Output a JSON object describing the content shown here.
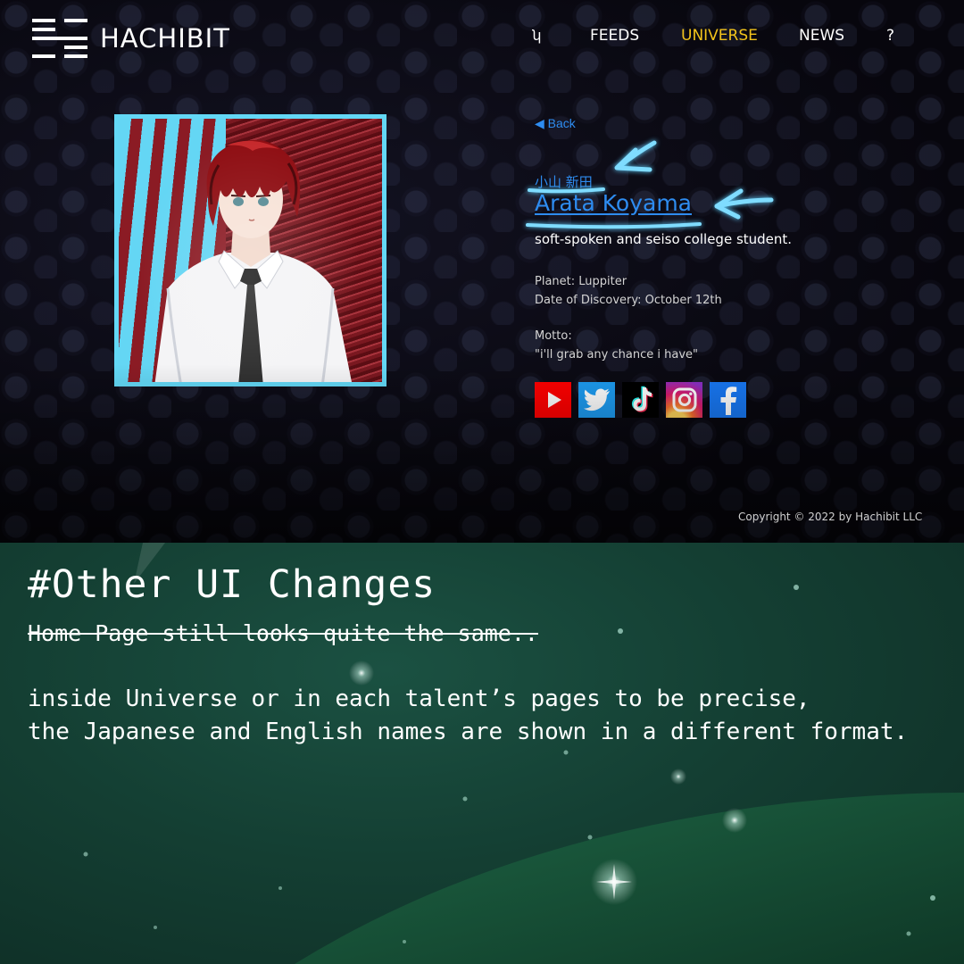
{
  "site": {
    "logo_text": "HACHIBIT",
    "nav": {
      "home": "ʮ",
      "feeds": "FEEDS",
      "universe": "UNIVERSE",
      "news": "NEWS",
      "help": "?"
    },
    "active_nav": "UNIVERSE",
    "accent_color": "#f2c31b",
    "link_color": "#2e8cf0",
    "portrait_border_color": "#63d8f6",
    "talent": {
      "back_label": "◀ Back",
      "japanese_name": "小山 新田",
      "english_name": "Arata Koyama",
      "tagline": "soft-spoken and seiso college student.",
      "planet": "Planet: Luppiter",
      "discovery": "Date of Discovery: October 12th",
      "motto_label": "Motto:",
      "motto": "\"i'll grab any chance i have\""
    },
    "socials": [
      "youtube-icon",
      "twitter-icon",
      "tiktok-icon",
      "instagram-icon",
      "facebook-icon"
    ],
    "copyright": "Copyright © 2022 by Hachibit LLC"
  },
  "notes": {
    "title": "#Other UI Changes",
    "struck_line": "Home Page still looks quite the same..",
    "line1": "inside Universe or in each talent’s pages to be precise,",
    "line2": "the Japanese and English names are shown in a different format."
  }
}
